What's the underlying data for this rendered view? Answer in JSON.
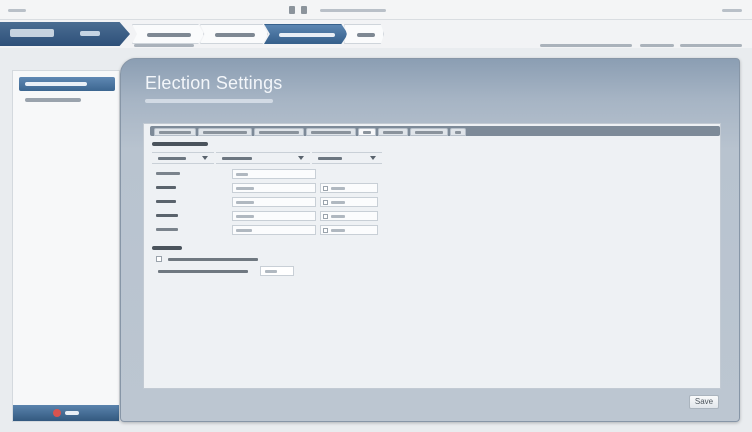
{
  "topbar": {
    "icons": [
      "window-icon",
      "help-icon"
    ]
  },
  "election_header": {
    "page_title": "Election Settings",
    "subtitle": ""
  },
  "actions": {
    "save_label": "Save"
  },
  "other_settings": {
    "default_value": ""
  }
}
